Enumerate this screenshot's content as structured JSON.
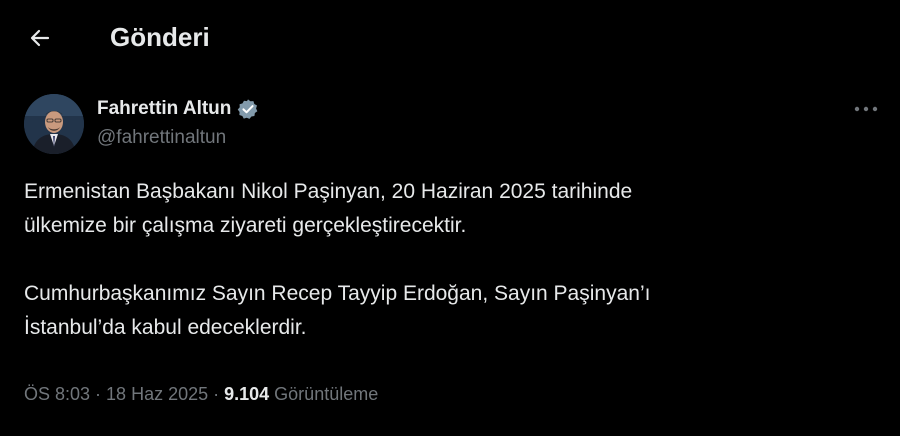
{
  "header": {
    "back_icon": "arrow-left-icon",
    "title": "Gönderi"
  },
  "author": {
    "name": "Fahrettin Altun",
    "handle": "@fahrettinaltun",
    "verified_icon": "verified-badge-icon",
    "verified_color": "#829aab"
  },
  "more_icon": "more-horizontal-icon",
  "tweet": {
    "line1": "Ermenistan Başbakanı Nikol Paşinyan, 20 Haziran 2025 tarihinde",
    "line2": "ülkemize bir çalışma ziyareti gerçekleştirecektir.",
    "line3": "Cumhurbaşkanımız Sayın Recep Tayyip Erdoğan, Sayın Paşinyan’ı",
    "line4": "İstanbul’da kabul edeceklerdir."
  },
  "meta": {
    "time": "ÖS 8:03",
    "separator": "·",
    "date": "18 Haz 2025",
    "views_count": "9.104",
    "views_label": "Görüntüleme"
  },
  "colors": {
    "background": "#000000",
    "text_primary": "#e7e9ea",
    "text_secondary": "#71767b"
  }
}
